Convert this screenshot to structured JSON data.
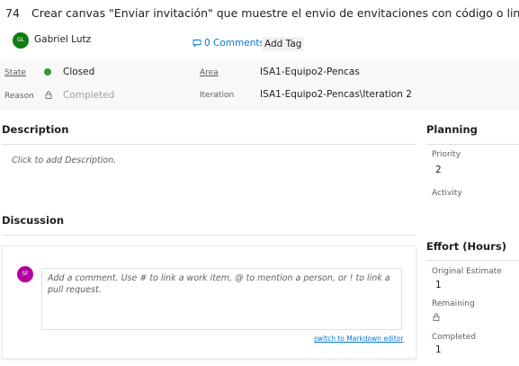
{
  "work_item": {
    "id": "74",
    "title": "Crear canvas \"Enviar invitación\" que muestre el envio de envitaciones con código o link",
    "assignee": {
      "initials": "GL",
      "name": "Gabriel Lutz",
      "avatar_color": "#107c10"
    },
    "comments_label": "0 Comments",
    "add_tag_label": "Add Tag"
  },
  "meta": {
    "state_label": "State",
    "state_value": "Closed",
    "state_color": "#339933",
    "reason_label": "Reason",
    "reason_value": "Completed",
    "area_label": "Area",
    "area_value": "ISA1-Equipo2-Pencas",
    "iteration_label": "Iteration",
    "iteration_value": "ISA1-Equipo2-Pencas\\Iteration 2"
  },
  "description": {
    "title": "Description",
    "placeholder": "Click to add Description."
  },
  "discussion": {
    "title": "Discussion",
    "avatar_initials": "SF",
    "avatar_color": "#b4009e",
    "comment_placeholder": "Add a comment. Use # to link a work item, @ to mention a person, or ! to link a pull request.",
    "markdown_link": "switch to Markdown editor"
  },
  "planning": {
    "title": "Planning",
    "priority_label": "Priority",
    "priority_value": "2",
    "activity_label": "Activity"
  },
  "effort": {
    "title": "Effort (Hours)",
    "original_estimate_label": "Original Estimate",
    "original_estimate_value": "1",
    "remaining_label": "Remaining",
    "completed_label": "Completed",
    "completed_value": "1"
  }
}
